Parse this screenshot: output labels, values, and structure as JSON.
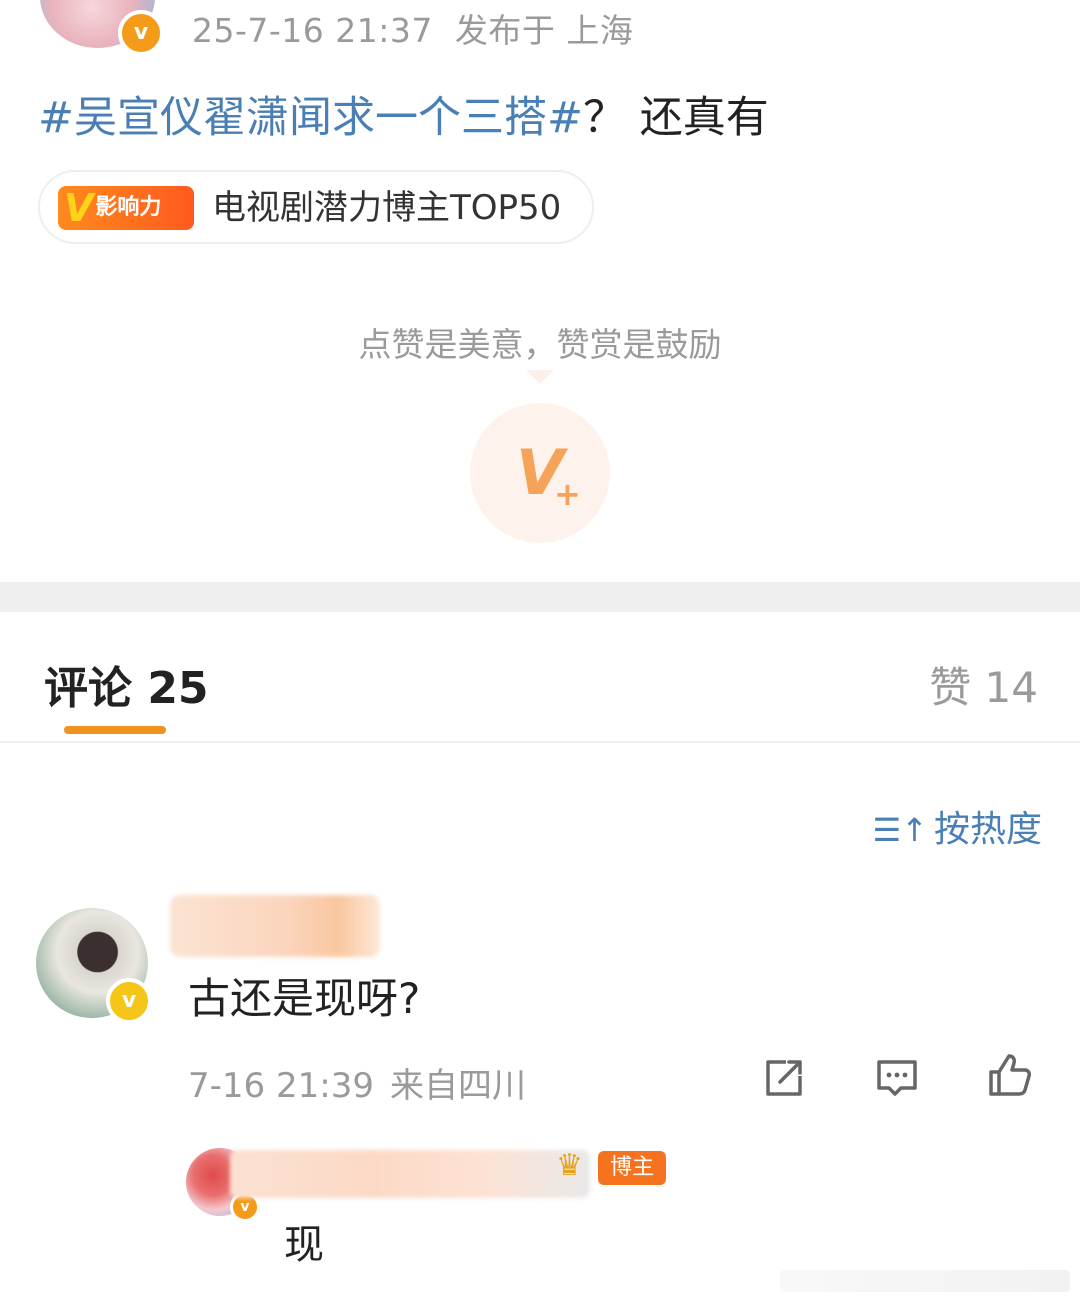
{
  "post": {
    "timestamp": "25-7-16 21:37",
    "location": "发布于 上海",
    "topic": "#吴宣仪翟潇闻求一个三搭#",
    "text_rest": "？ 还真有",
    "influence_badge": "影响力",
    "influence_title": "电视剧潜力博主TOP50",
    "reward_caption": "点赞是美意，赞赏是鼓励"
  },
  "tabs": {
    "comments": "评论 25",
    "likes": "赞 14"
  },
  "sort": {
    "label": "按热度"
  },
  "comment": {
    "text": "古还是现呀?",
    "time": "7-16 21:39",
    "location": "来自四川"
  },
  "reply": {
    "owner_tag": "博主",
    "text": "现"
  },
  "icons": [
    "verified-icon",
    "v-plus-reward-icon",
    "sort-icon",
    "share-icon",
    "reply-icon",
    "like-icon",
    "crown-icon"
  ],
  "colors": {
    "topic_link": "#4a7fb5",
    "accent_orange": "#f0921f",
    "muted_text": "#9a9a9a"
  }
}
